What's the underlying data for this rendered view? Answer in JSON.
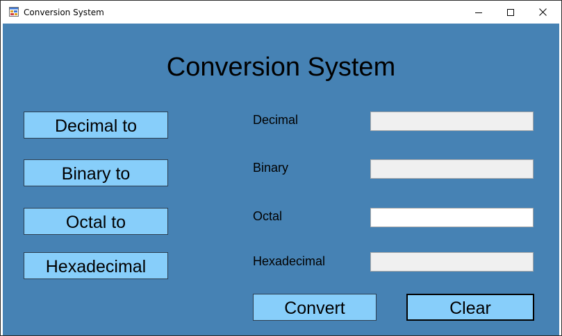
{
  "window": {
    "title": "Conversion System",
    "controls": {
      "minimize": "minimize",
      "maximize": "maximize",
      "close": "close"
    }
  },
  "heading": "Conversion System",
  "left_buttons": [
    {
      "label": "Decimal to"
    },
    {
      "label": "Binary to"
    },
    {
      "label": "Octal to"
    },
    {
      "label": "Hexadecimal"
    }
  ],
  "fields": [
    {
      "label": "Decimal",
      "value": "",
      "enabled": false
    },
    {
      "label": "Binary",
      "value": "",
      "enabled": false
    },
    {
      "label": "Octal",
      "value": "",
      "enabled": true
    },
    {
      "label": "Hexadecimal",
      "value": "",
      "enabled": false
    }
  ],
  "actions": {
    "convert": "Convert",
    "clear": "Clear"
  },
  "icons": {
    "app": "app-window-icon",
    "minimize": "minimize-icon",
    "maximize": "maximize-icon",
    "close": "close-icon"
  },
  "colors": {
    "form_background": "#4682b4",
    "button_background": "#87cefa"
  }
}
